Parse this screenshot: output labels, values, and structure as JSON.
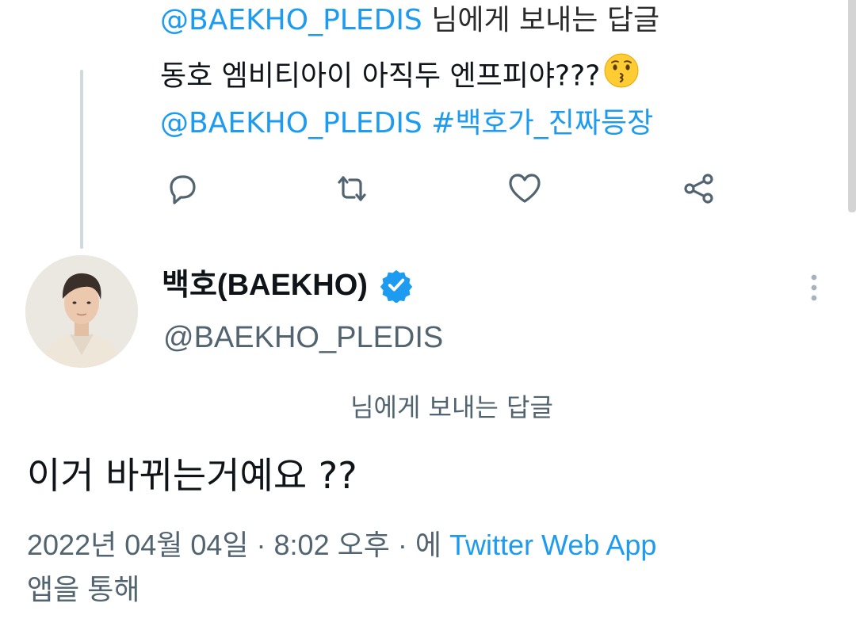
{
  "parent_tweet": {
    "reply_to_handle": "@BAEKHO_PLEDIS",
    "reply_to_suffix": " 님에게 보내는 답글",
    "text": "동호 엠비티아이 아직두 엔프피야???",
    "mention": "@BAEKHO_PLEDIS",
    "hashtag": "#백호가_진짜등장",
    "emoji": "kissing-face"
  },
  "actions": {
    "reply_icon": "reply-icon",
    "retweet_icon": "retweet-icon",
    "like_icon": "heart-icon",
    "share_icon": "share-icon"
  },
  "reply_tweet": {
    "display_name": "백호(BAEKHO)",
    "handle": "@BAEKHO_PLEDIS",
    "verified": true,
    "reply_label": "님에게 보내는 답글",
    "text": "이거 바뀌는거예요 ??",
    "timestamp": "2022년 04월 04일 · 8:02 오후 · 에",
    "source": "Twitter Web App",
    "source_suffix": "앱을 통해"
  },
  "colors": {
    "link": "#1d9bf0",
    "muted": "#536471",
    "text": "#0f1419",
    "thread_line": "#cfd9de"
  }
}
